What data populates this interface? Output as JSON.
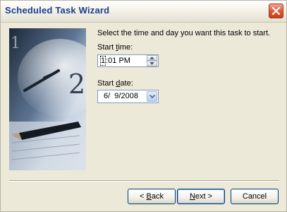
{
  "window": {
    "title": "Scheduled Task Wizard"
  },
  "main": {
    "instruction": "Select the time and day you want this task to start.",
    "start_time": {
      "label_prefix": "Start ",
      "label_accel": "t",
      "label_suffix": "ime:",
      "value_cursor": "1",
      "value_rest": ":01 PM"
    },
    "start_date": {
      "label_prefix": "Start ",
      "label_accel": "d",
      "label_suffix": "ate:",
      "value": "6/  9/2008"
    }
  },
  "buttons": {
    "back": {
      "prefix": "< ",
      "accel": "B",
      "rest": "ack"
    },
    "next": {
      "prefix": "",
      "accel": "N",
      "rest": "ext >"
    },
    "cancel": {
      "label": "Cancel"
    }
  },
  "colors": {
    "title_text": "#1a3f8c",
    "close_button": "#d9572e",
    "dialog_bg": "#ece9d8"
  },
  "icons": {
    "close": "close-x-icon",
    "spin_up": "arrow-up-icon",
    "spin_down": "arrow-down-icon",
    "dropdown": "chevron-down-icon"
  }
}
